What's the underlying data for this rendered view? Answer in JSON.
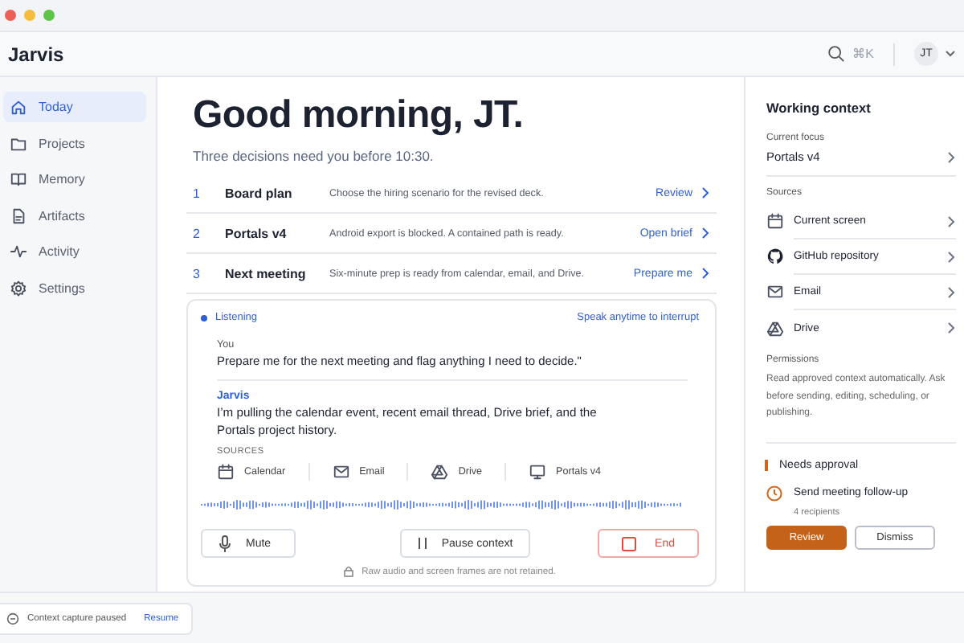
{
  "app": {
    "title": "Jarvis",
    "shortcut": "⌘K",
    "avatar": "JT"
  },
  "sidebar": {
    "items": [
      {
        "label": "Today",
        "selected": true
      },
      {
        "label": "Projects",
        "selected": false
      },
      {
        "label": "Memory",
        "selected": false
      },
      {
        "label": "Artifacts",
        "selected": false
      },
      {
        "label": "Activity",
        "selected": false
      },
      {
        "label": "Settings",
        "selected": false
      }
    ]
  },
  "main": {
    "greeting": "Good morning, JT.",
    "subtitle": "Three decisions need you before 10:30.",
    "decisions": [
      {
        "number": "1",
        "title": "Board plan",
        "description": "Choose the hiring scenario for the revised deck.",
        "action": "Review"
      },
      {
        "number": "2",
        "title": "Portals v4",
        "description": "Android export is blocked. A contained path is ready.",
        "action": "Open brief"
      },
      {
        "number": "3",
        "title": "Next meeting",
        "description": "Six-minute prep is ready from calendar, email, and Drive.",
        "action": "Prepare me"
      }
    ],
    "session": {
      "status": "Listening",
      "hint": "Speak anytime to interrupt",
      "user_label": "You",
      "user_text": "Prepare me for the next meeting and flag anything I need to decide.\"",
      "assistant_label": "Jarvis",
      "assistant_text": "I’m pulling the calendar event, recent email thread, Drive brief, and the Portals project history.",
      "sources_label": "SOURCES",
      "sources": [
        "Calendar",
        "Email",
        "Drive",
        "Portals v4"
      ],
      "buttons": {
        "mute": "Mute",
        "pause": "Pause context",
        "end": "End"
      },
      "footnote": "Raw audio and screen frames are not retained."
    }
  },
  "context": {
    "title": "Working context",
    "focus_label": "Current focus",
    "focus_value": "Portals v4",
    "sources_label": "Sources",
    "sources": [
      "Current screen",
      "GitHub repository",
      "Email",
      "Drive"
    ],
    "permissions_label": "Permissions",
    "permissions_text": "Read approved context automatically. Ask before sending, editing, scheduling, or publishing.",
    "approval": {
      "heading": "Needs approval",
      "title": "Send meeting follow-up",
      "detail": "4 recipients",
      "primary": "Review",
      "secondary": "Dismiss"
    }
  },
  "status_bar": {
    "text": "Context capture paused",
    "action": "Resume"
  }
}
